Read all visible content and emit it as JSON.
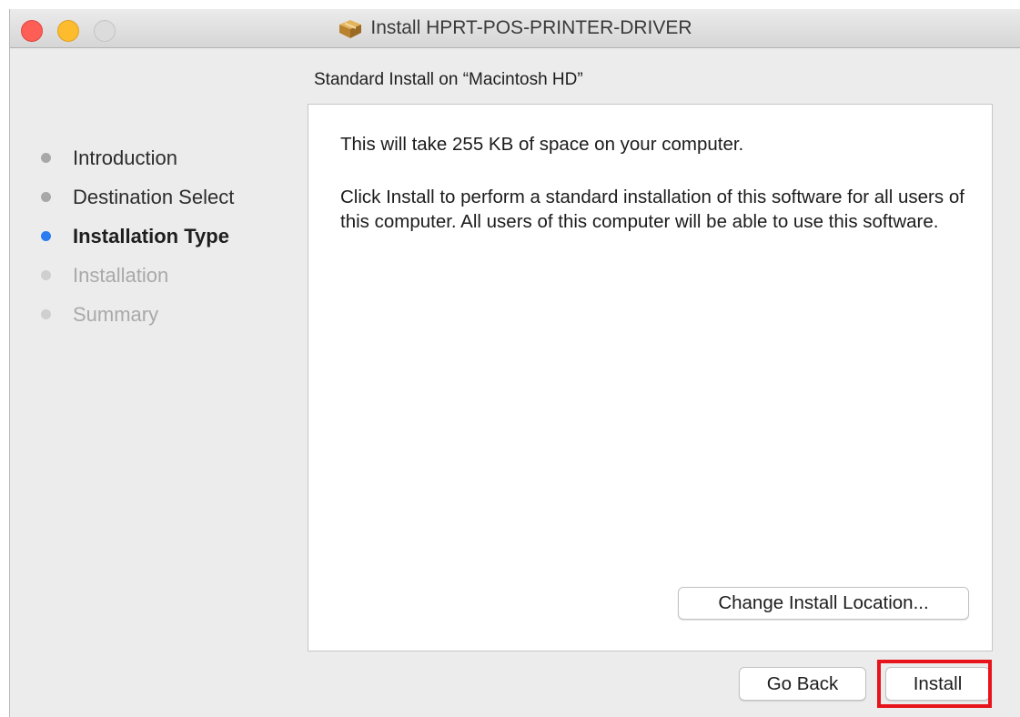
{
  "window": {
    "title": "Install HPRT-POS-PRINTER-DRIVER",
    "icon": "package-icon"
  },
  "heading": "Standard Install on “Macintosh HD”",
  "steps": [
    {
      "label": "Introduction",
      "state": "done"
    },
    {
      "label": "Destination Select",
      "state": "done"
    },
    {
      "label": "Installation Type",
      "state": "current"
    },
    {
      "label": "Installation",
      "state": "future"
    },
    {
      "label": "Summary",
      "state": "future"
    }
  ],
  "panel": {
    "space_text": "This will take 255 KB of space on your computer.",
    "description": "Click Install to perform a standard installation of this software for all users of this computer. All users of this computer will be able to use this software.",
    "change_location_label": "Change Install Location..."
  },
  "buttons": {
    "go_back": "Go Back",
    "install": "Install"
  },
  "colors": {
    "current_step": "#2b7cf1",
    "highlight_box": "#e8141b",
    "close": "#fd5f57",
    "minimize": "#fdbc2e"
  }
}
